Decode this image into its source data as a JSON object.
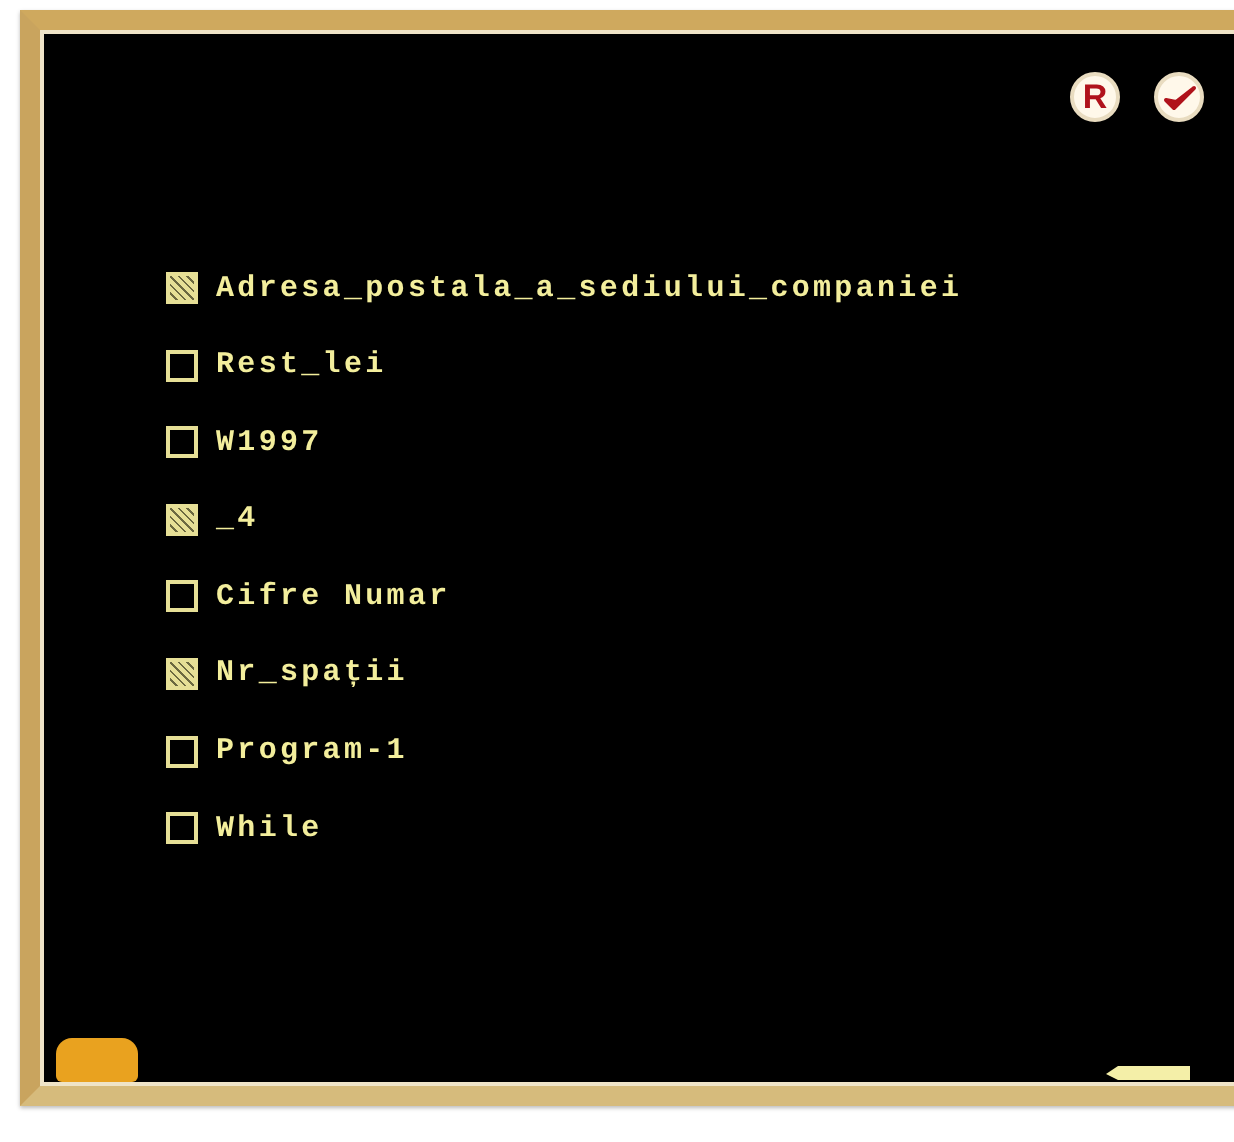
{
  "toolbar": {
    "reset_label": "R"
  },
  "options": [
    {
      "label": "Adresa_postala_a_sediului_companiei",
      "checked": true
    },
    {
      "label": "Rest_lei",
      "checked": false
    },
    {
      "label": "W1997",
      "checked": false
    },
    {
      "label": "_4",
      "checked": true
    },
    {
      "label": "Cifre Numar",
      "checked": false
    },
    {
      "label": "Nr_spații",
      "checked": true
    },
    {
      "label": "Program-1",
      "checked": false
    },
    {
      "label": "While",
      "checked": false
    }
  ]
}
